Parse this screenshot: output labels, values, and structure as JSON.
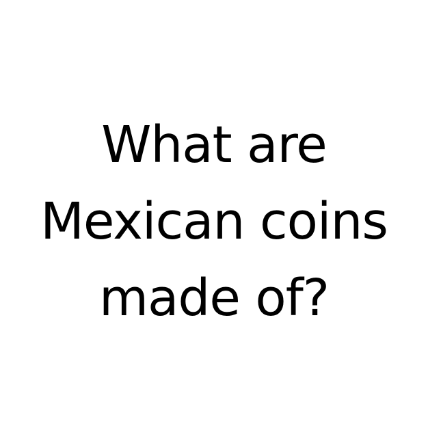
{
  "question": {
    "lines": [
      "What are",
      "Mexican coins",
      "made of?"
    ]
  }
}
